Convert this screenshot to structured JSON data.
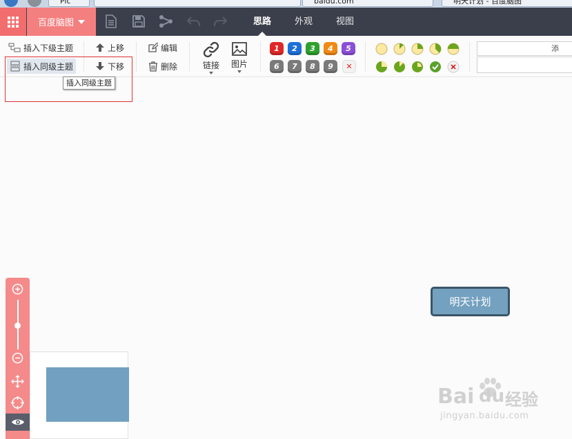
{
  "browser_tabs": [
    {
      "label": "Pic"
    },
    {
      "label": "baidu.com"
    },
    {
      "label": "明天计划 - 百度脑图"
    }
  ],
  "topbar": {
    "brand_label": "百度脑图",
    "tabs": [
      {
        "label": "思路",
        "active": true
      },
      {
        "label": "外观",
        "active": false
      },
      {
        "label": "视图",
        "active": false
      }
    ]
  },
  "ribbon": {
    "insert_child": "插入下级主题",
    "insert_sibling": "插入同级主题",
    "move_up": "上移",
    "move_down": "下移",
    "edit": "编辑",
    "delete": "删除",
    "link": "链接",
    "image": "图片",
    "priorities": [
      {
        "label": "1",
        "color": "#e02828"
      },
      {
        "label": "2",
        "color": "#1e6fd8"
      },
      {
        "label": "3",
        "color": "#2ea02e"
      },
      {
        "label": "4",
        "color": "#f08a14"
      },
      {
        "label": "5",
        "color": "#8a4fd6"
      },
      {
        "label": "6",
        "color": "#7a7a7a"
      },
      {
        "label": "7",
        "color": "#7a7a7a"
      },
      {
        "label": "8",
        "color": "#7a7a7a"
      },
      {
        "label": "9",
        "color": "#7a7a7a"
      }
    ],
    "priority_remove": "✕",
    "resource_placeholder": "添"
  },
  "tooltip": {
    "text": "插入同级主题"
  },
  "canvas": {
    "root_node": "明天计划",
    "node_color": "#73a1bf",
    "node_border": "#3b5568"
  },
  "watermark": {
    "text_bai": "Bai",
    "text_du": "du",
    "text_jingyan": "经验",
    "url": "jingyan.baidu.com"
  },
  "colors": {
    "accent": "#f47f7f",
    "topbar": "#3b3f4b"
  }
}
